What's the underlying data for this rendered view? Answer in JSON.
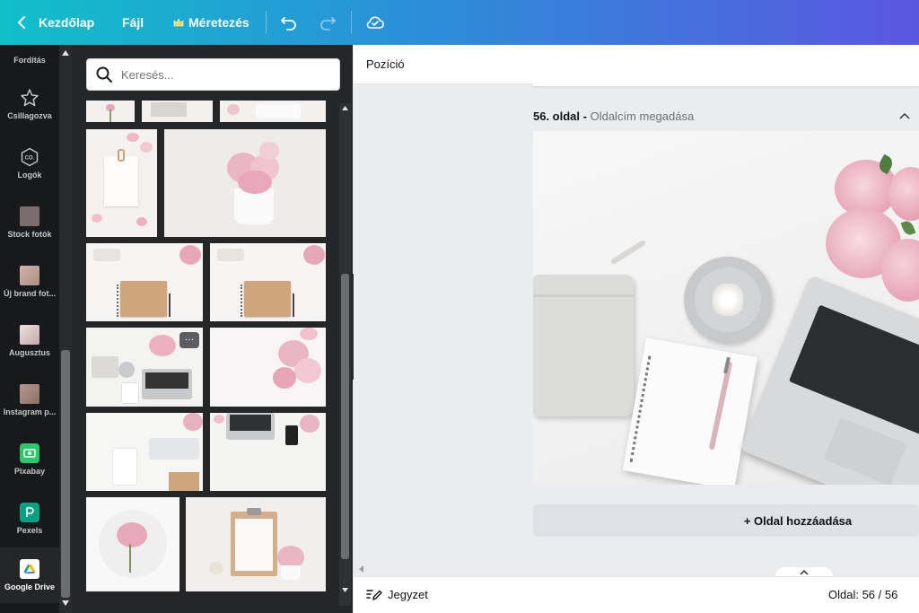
{
  "topbar": {
    "back_label": "Kezdőlap",
    "file_label": "Fájl",
    "resize_label": "Méretezés"
  },
  "siderail": {
    "items": [
      {
        "label": "Fordítás",
        "icon": "translate-icon"
      },
      {
        "label": "Csillagozva",
        "icon": "star-icon"
      },
      {
        "label": "Logók",
        "icon": "logo-icon"
      },
      {
        "label": "Stock fotók",
        "icon": "stock-photos-icon"
      },
      {
        "label": "Új brand fot...",
        "icon": "brand-photo-icon"
      },
      {
        "label": "Augusztus",
        "icon": "folder-thumb-icon"
      },
      {
        "label": "Instagram p...",
        "icon": "instagram-thumb-icon"
      },
      {
        "label": "Pixabay",
        "icon": "pixabay-icon"
      },
      {
        "label": "Pexels",
        "icon": "pexels-icon"
      },
      {
        "label": "Google Drive",
        "icon": "google-drive-icon"
      }
    ]
  },
  "panel": {
    "search_placeholder": "Keresés..."
  },
  "toolbar": {
    "position_label": "Pozíció"
  },
  "page": {
    "number_label": "56. oldal",
    "separator": " - ",
    "title_placeholder": "Oldalcím megadása",
    "add_page_label": "+ Oldal hozzáadása"
  },
  "bottombar": {
    "notes_label": "Jegyzet",
    "page_counter": "Oldal: 56 / 56"
  },
  "colors": {
    "accent_start": "#11bfc9",
    "accent_end": "#5b56e0",
    "panel_bg": "#252627",
    "rail_bg": "#18191b"
  }
}
